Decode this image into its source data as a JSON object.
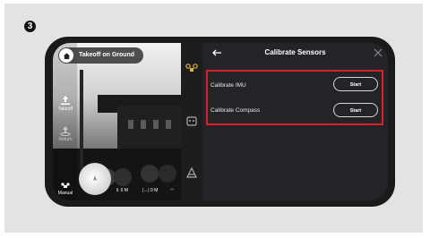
{
  "step_number": "3",
  "status": {
    "label": "Takeoff on Ground"
  },
  "left_rail": {
    "takeoff_label": "Takeoff",
    "return_label": "Return",
    "mode_label": "Manual"
  },
  "telemetry": {
    "altitude": "0 M",
    "distance": "0 M"
  },
  "panel": {
    "title": "Calibrate Sensors",
    "rows": [
      {
        "label": "Calibrate IMU",
        "button": "Start"
      },
      {
        "label": "Calibrate Compass",
        "button": "Start"
      }
    ]
  },
  "colors": {
    "highlight": "#d6202a",
    "panel_bg": "#242428",
    "side_icon_accent": "#e3b23c"
  }
}
